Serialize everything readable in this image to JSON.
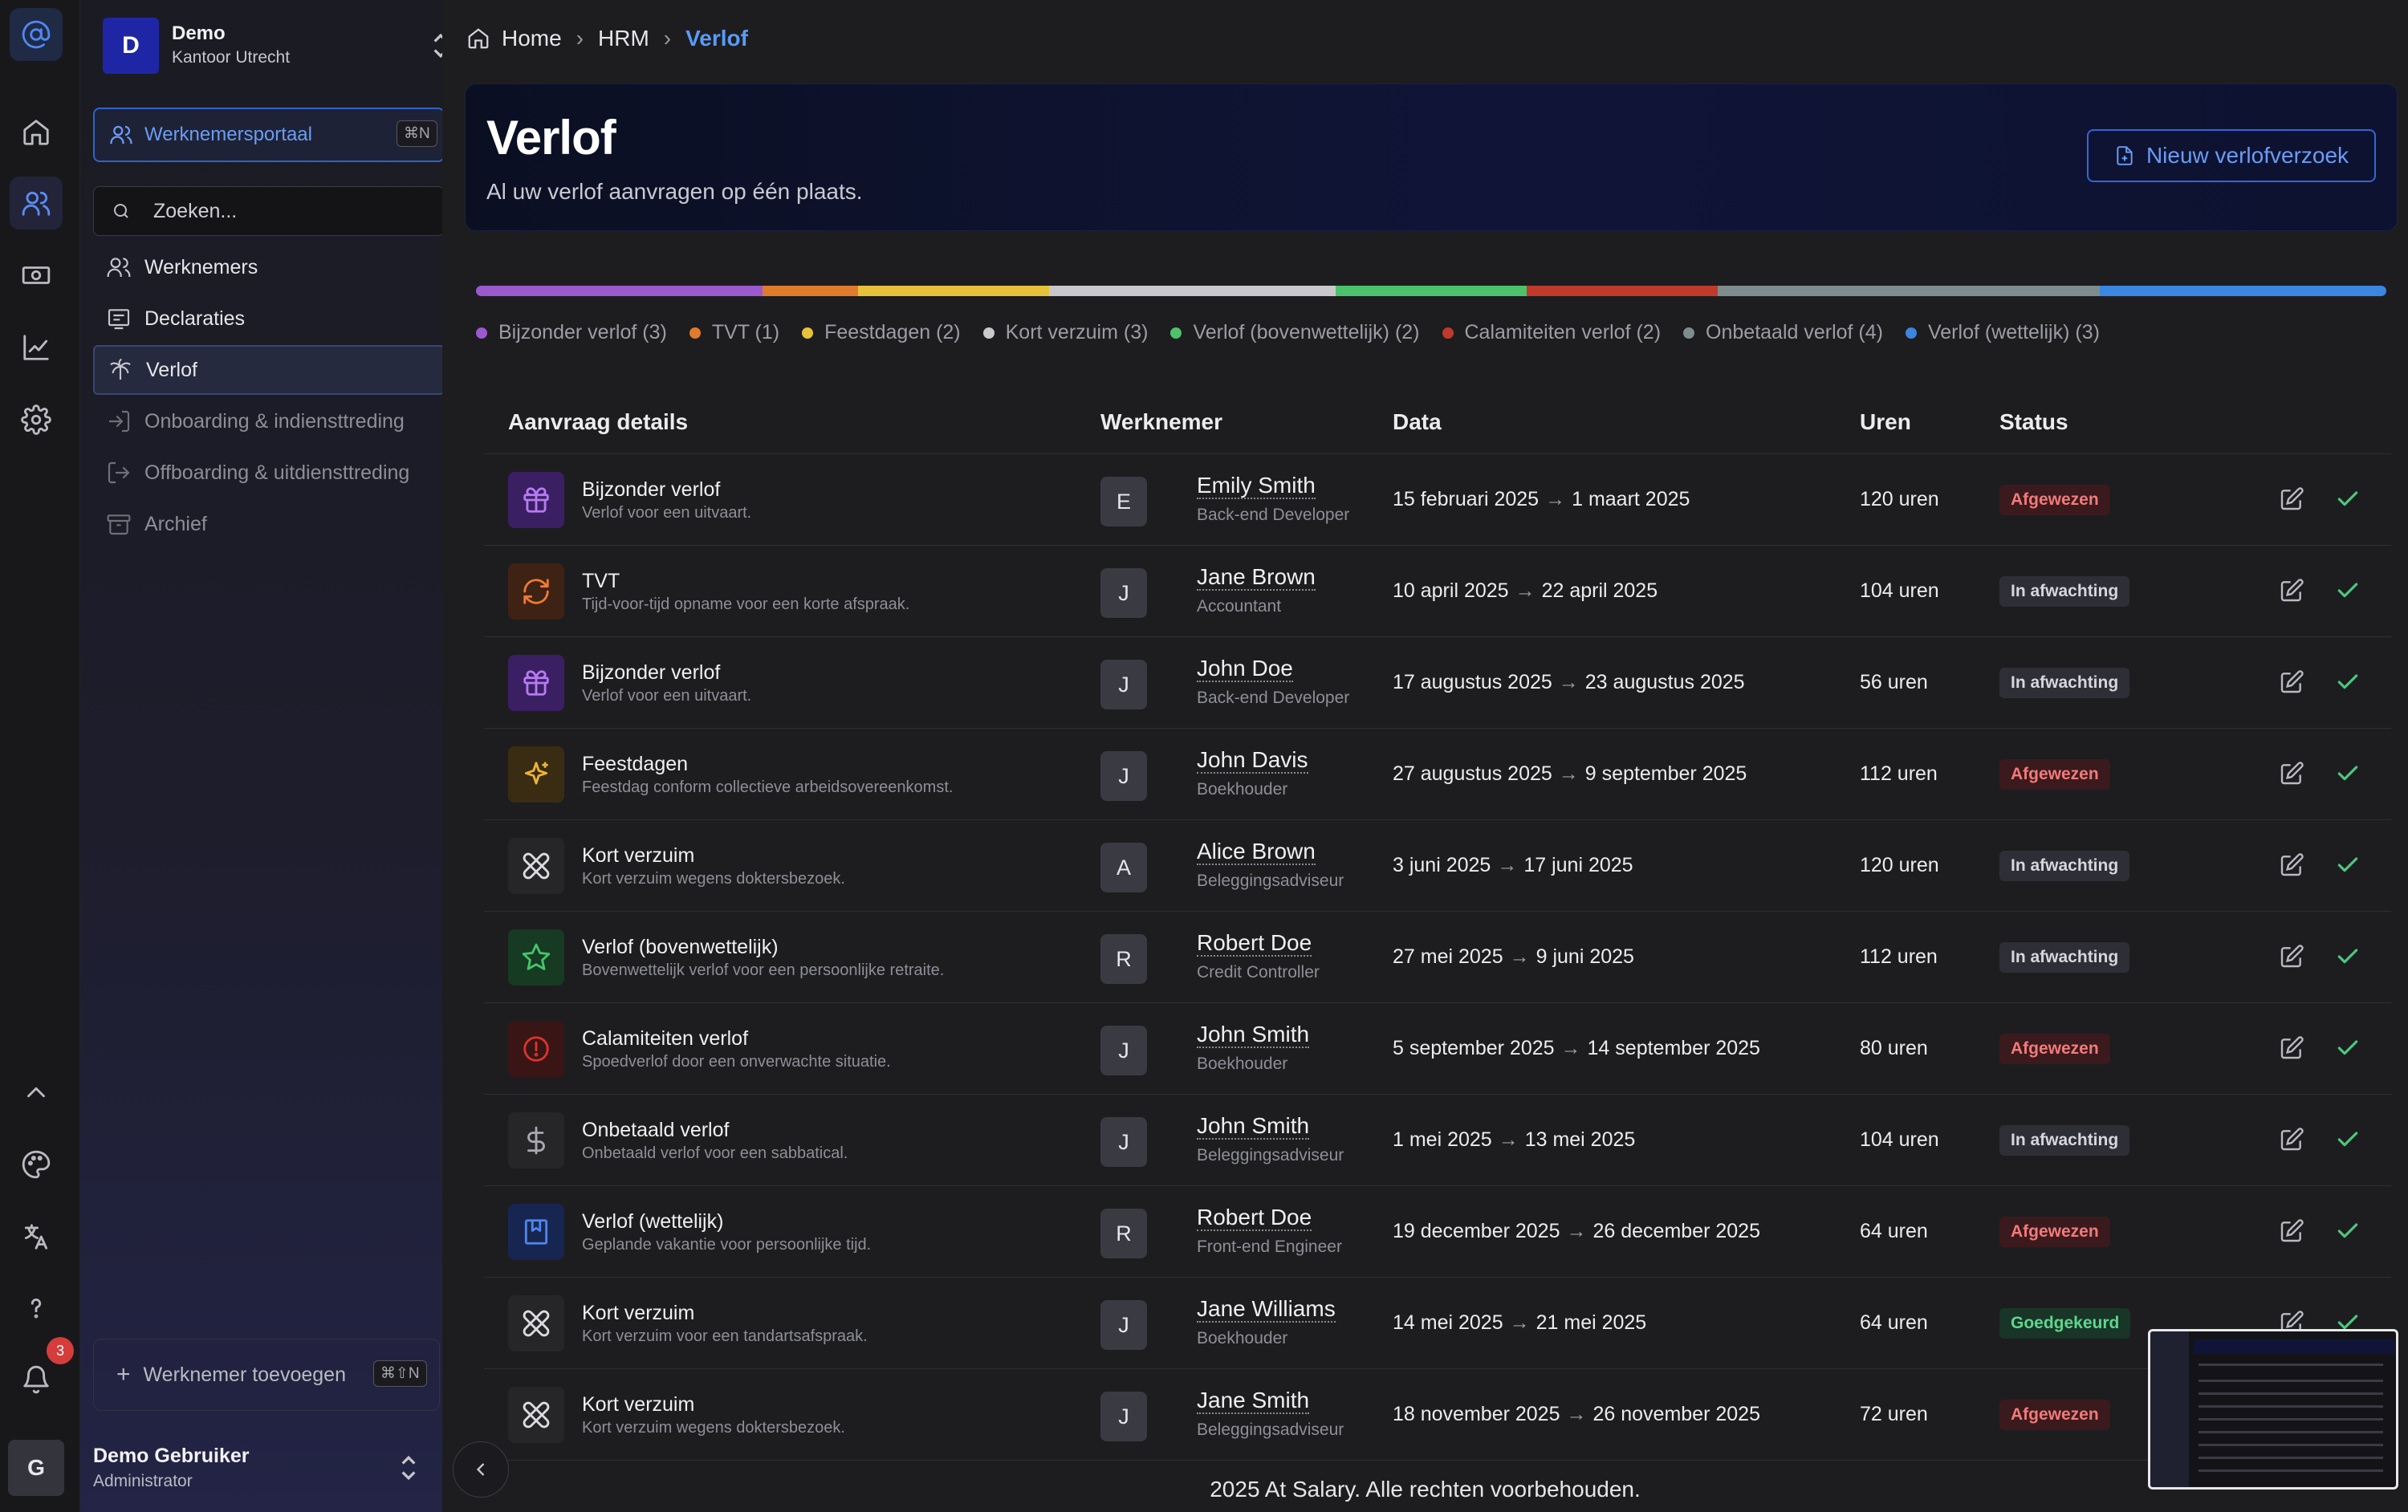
{
  "rail": {
    "icons": [
      "at-logo-icon",
      "home-icon",
      "users-icon",
      "money-icon",
      "chart-icon",
      "gear-icon",
      "chevron-up-icon",
      "palette-icon",
      "translate-icon",
      "help-icon",
      "bell-icon"
    ],
    "notification_count": "3"
  },
  "org": {
    "initial": "D",
    "name": "Demo",
    "location": "Kantoor Utrecht"
  },
  "portal": {
    "label": "Werknemersportaal",
    "shortcut": "⌘N"
  },
  "search": {
    "placeholder": "Zoeken..."
  },
  "nav": [
    {
      "label": "Werknemers",
      "icon": "users-icon"
    },
    {
      "label": "Declaraties",
      "icon": "receipt-icon"
    },
    {
      "label": "Verlof",
      "icon": "palm-tree-icon"
    },
    {
      "label": "Onboarding & indiensttreding",
      "icon": "login-icon"
    },
    {
      "label": "Offboarding & uitdiensttreding",
      "icon": "logout-icon"
    },
    {
      "label": "Archief",
      "icon": "archive-icon"
    }
  ],
  "add_employee": {
    "label": "Werknemer toevoegen",
    "shortcut": "⌘⇧N"
  },
  "user": {
    "initial": "G",
    "name": "Demo Gebruiker",
    "role": "Administrator"
  },
  "breadcrumb": {
    "home": "Home",
    "section": "HRM",
    "current": "Verlof"
  },
  "hero": {
    "title": "Verlof",
    "subtitle": "Al uw verlof aanvragen op één plaats.",
    "button": "Nieuw verlofverzoek"
  },
  "distribution": [
    {
      "label": "Bijzonder verlof (3)",
      "count": 3,
      "color": "#9b59d0"
    },
    {
      "label": "TVT (1)",
      "count": 1,
      "color": "#e07b2c"
    },
    {
      "label": "Feestdagen (2)",
      "count": 2,
      "color": "#e8c13a"
    },
    {
      "label": "Kort verzuim (3)",
      "count": 3,
      "color": "#c9c9cd"
    },
    {
      "label": "Verlof (bovenwettelijk) (2)",
      "count": 2,
      "color": "#4cc36a"
    },
    {
      "label": "Calamiteiten verlof (2)",
      "count": 2,
      "color": "#c0392b"
    },
    {
      "label": "Onbetaald verlof (4)",
      "count": 4,
      "color": "#7f8c8d"
    },
    {
      "label": "Verlof (wettelijk) (3)",
      "count": 3,
      "color": "#3a86e0"
    }
  ],
  "table": {
    "headers": [
      "Aanvraag details",
      "Werknemer",
      "Data",
      "Uren",
      "Status"
    ],
    "rows": [
      {
        "type": "Bijzonder verlof",
        "desc": "Verlof voor een uitvaart.",
        "icon": "gift-icon",
        "initial": "E",
        "name": "Emily Smith",
        "role": "Back-end Developer",
        "start": "15 februari 2025",
        "end": "1 maart 2025",
        "hours": "120 uren",
        "status": "Afgewezen"
      },
      {
        "type": "TVT",
        "desc": "Tijd-voor-tijd opname voor een korte afspraak.",
        "icon": "refresh-icon",
        "initial": "J",
        "name": "Jane Brown",
        "role": "Accountant",
        "start": "10 april 2025",
        "end": "22 april 2025",
        "hours": "104 uren",
        "status": "In afwachting"
      },
      {
        "type": "Bijzonder verlof",
        "desc": "Verlof voor een uitvaart.",
        "icon": "gift-icon",
        "initial": "J",
        "name": "John Doe",
        "role": "Back-end Developer",
        "start": "17 augustus 2025",
        "end": "23 augustus 2025",
        "hours": "56 uren",
        "status": "In afwachting"
      },
      {
        "type": "Feestdagen",
        "desc": "Feestdag conform collectieve arbeidsovereenkomst.",
        "icon": "sparkle-icon",
        "initial": "J",
        "name": "John Davis",
        "role": "Boekhouder",
        "start": "27 augustus 2025",
        "end": "9 september 2025",
        "hours": "112 uren",
        "status": "Afgewezen"
      },
      {
        "type": "Kort verzuim",
        "desc": "Kort verzuim wegens doktersbezoek.",
        "icon": "bandage-icon",
        "initial": "A",
        "name": "Alice Brown",
        "role": "Beleggingsadviseur",
        "start": "3 juni 2025",
        "end": "17 juni 2025",
        "hours": "120 uren",
        "status": "In afwachting"
      },
      {
        "type": "Verlof (bovenwettelijk)",
        "desc": "Bovenwettelijk verlof voor een persoonlijke retraite.",
        "icon": "star-icon",
        "initial": "R",
        "name": "Robert Doe",
        "role": "Credit Controller",
        "start": "27 mei 2025",
        "end": "9 juni 2025",
        "hours": "112 uren",
        "status": "In afwachting"
      },
      {
        "type": "Calamiteiten verlof",
        "desc": "Spoedverlof door een onverwachte situatie.",
        "icon": "alert-circle-icon",
        "initial": "J",
        "name": "John Smith",
        "role": "Boekhouder",
        "start": "5 september 2025",
        "end": "14 september 2025",
        "hours": "80 uren",
        "status": "Afgewezen"
      },
      {
        "type": "Onbetaald verlof",
        "desc": "Onbetaald verlof voor een sabbatical.",
        "icon": "dollar-icon",
        "initial": "J",
        "name": "John Smith",
        "role": "Beleggingsadviseur",
        "start": "1 mei 2025",
        "end": "13 mei 2025",
        "hours": "104 uren",
        "status": "In afwachting"
      },
      {
        "type": "Verlof (wettelijk)",
        "desc": "Geplande vakantie voor persoonlijke tijd.",
        "icon": "bookmark-icon",
        "initial": "R",
        "name": "Robert Doe",
        "role": "Front-end Engineer",
        "start": "19 december 2025",
        "end": "26 december 2025",
        "hours": "64 uren",
        "status": "Afgewezen"
      },
      {
        "type": "Kort verzuim",
        "desc": "Kort verzuim voor een tandartsafspraak.",
        "icon": "bandage-icon",
        "initial": "J",
        "name": "Jane Williams",
        "role": "Boekhouder",
        "start": "14 mei 2025",
        "end": "21 mei 2025",
        "hours": "64 uren",
        "status": "Goedgekeurd"
      },
      {
        "type": "Kort verzuim",
        "desc": "Kort verzuim wegens doktersbezoek.",
        "icon": "bandage-icon",
        "initial": "J",
        "name": "Jane Smith",
        "role": "Beleggingsadviseur",
        "start": "18 november 2025",
        "end": "26 november 2025",
        "hours": "72 uren",
        "status": "Afgewezen"
      }
    ]
  },
  "footer": "2025 At Salary. Alle rechten voorbehouden."
}
